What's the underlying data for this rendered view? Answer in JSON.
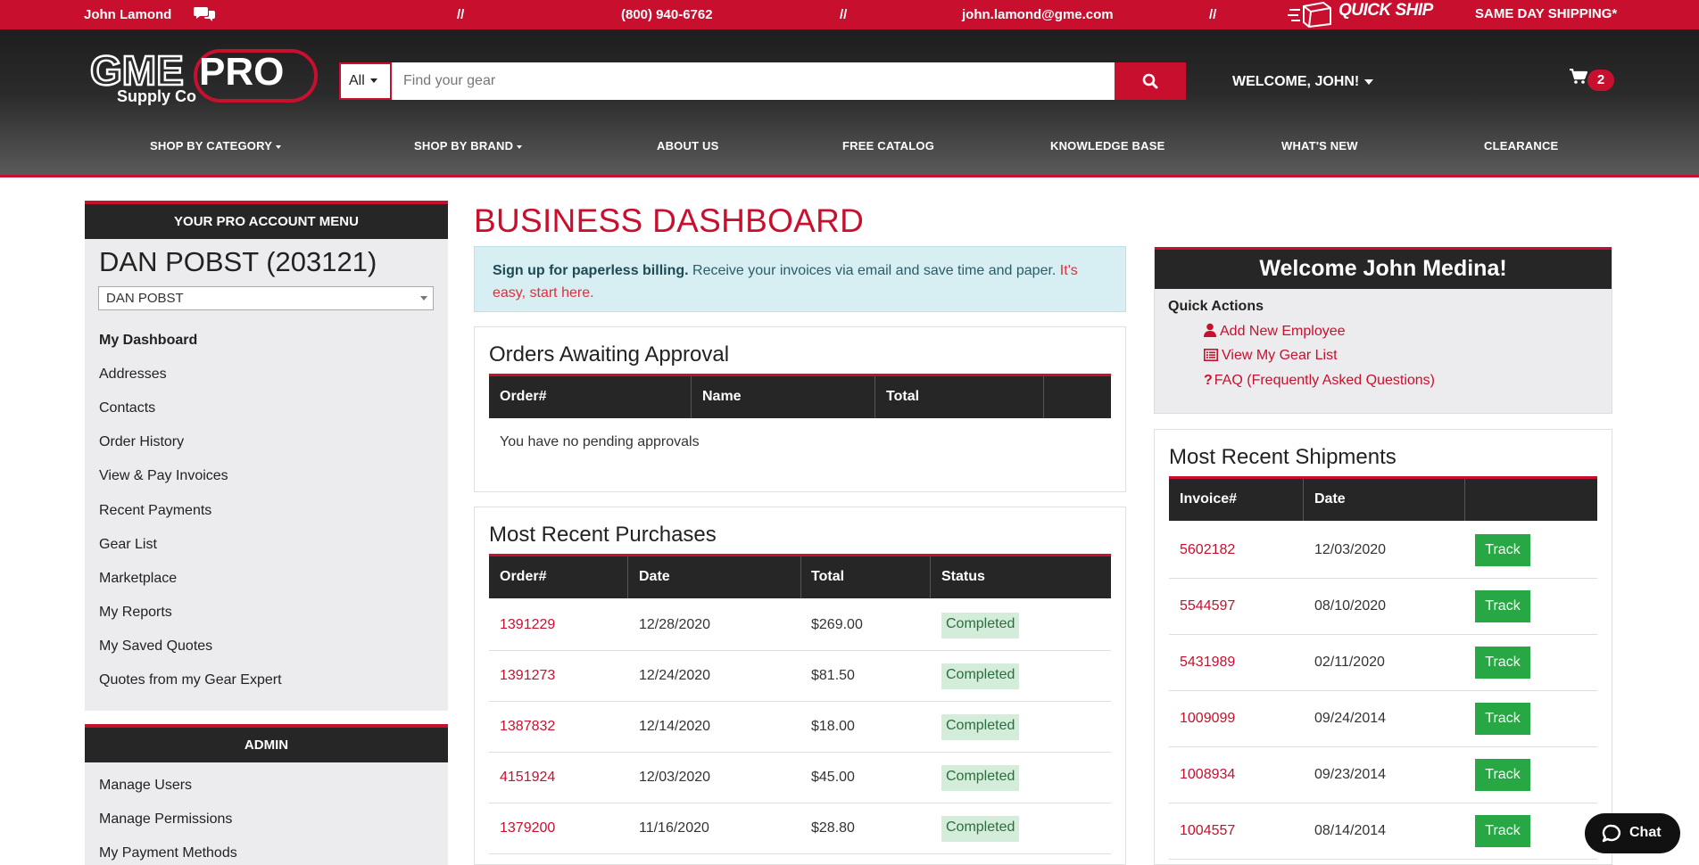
{
  "topbar": {
    "user_name": "John Lamond",
    "separator": "//",
    "phone": "(800) 940-6762",
    "email": "john.lamond@gme.com",
    "quick_ship": "QUICK SHIP",
    "same_day": "SAME DAY SHIPPING*"
  },
  "header": {
    "logo_text_gme": "GME",
    "logo_text_pro": "PRO",
    "logo_text_supply": "Supply Co",
    "search_scope": "All",
    "search_placeholder": "Find your gear",
    "welcome": "WELCOME, JOHN!",
    "cart_count": "2"
  },
  "nav": [
    {
      "label": "SHOP BY CATEGORY",
      "has_dropdown": true
    },
    {
      "label": "SHOP BY BRAND",
      "has_dropdown": true
    },
    {
      "label": "ABOUT US",
      "has_dropdown": false
    },
    {
      "label": "FREE CATALOG",
      "has_dropdown": false
    },
    {
      "label": "KNOWLEDGE BASE",
      "has_dropdown": false
    },
    {
      "label": "WHAT'S NEW",
      "has_dropdown": false
    },
    {
      "label": "CLEARANCE",
      "has_dropdown": false
    }
  ],
  "sidebar": {
    "menu_title": "YOUR PRO ACCOUNT MENU",
    "account_name": "DAN POBST (203121)",
    "account_select_value": "DAN POBST",
    "items": [
      {
        "label": "My Dashboard",
        "active": true
      },
      {
        "label": "Addresses"
      },
      {
        "label": "Contacts"
      },
      {
        "label": "Order History"
      },
      {
        "label": "View & Pay Invoices"
      },
      {
        "label": "Recent Payments"
      },
      {
        "label": "Gear List"
      },
      {
        "label": "Marketplace"
      },
      {
        "label": "My Reports"
      },
      {
        "label": "My Saved Quotes"
      },
      {
        "label": "Quotes from my Gear Expert"
      }
    ],
    "admin_title": "ADMIN",
    "admin_items": [
      {
        "label": "Manage Users"
      },
      {
        "label": "Manage Permissions"
      },
      {
        "label": "My Payment Methods"
      }
    ]
  },
  "main": {
    "title": "BUSINESS DASHBOARD",
    "alert": {
      "bold": "Sign up for paperless billing.",
      "text": " Receive your invoices via email and save time and paper. ",
      "link": "It's easy, start here."
    },
    "approvals": {
      "title": "Orders Awaiting Approval",
      "columns": [
        "Order#",
        "Name",
        "Total",
        ""
      ],
      "empty": "You have no pending approvals"
    },
    "purchases": {
      "title": "Most Recent Purchases",
      "columns": [
        "Order#",
        "Date",
        "Total",
        "Status"
      ],
      "rows": [
        {
          "order": "1391229",
          "date": "12/28/2020",
          "total": "$269.00",
          "status": "Completed"
        },
        {
          "order": "1391273",
          "date": "12/24/2020",
          "total": "$81.50",
          "status": "Completed"
        },
        {
          "order": "1387832",
          "date": "12/14/2020",
          "total": "$18.00",
          "status": "Completed"
        },
        {
          "order": "4151924",
          "date": "12/03/2020",
          "total": "$45.00",
          "status": "Completed"
        },
        {
          "order": "1379200",
          "date": "11/16/2020",
          "total": "$28.80",
          "status": "Completed"
        }
      ]
    }
  },
  "right": {
    "welcome_title": "Welcome John Medina!",
    "quick_actions_title": "Quick Actions",
    "quick_actions": [
      {
        "label": "Add New Employee",
        "icon": "user-icon"
      },
      {
        "label": "View My Gear List",
        "icon": "list-icon"
      },
      {
        "label": "FAQ (Frequently Asked Questions)",
        "icon": "question-icon"
      }
    ],
    "shipments": {
      "title": "Most Recent Shipments",
      "columns": [
        "Invoice#",
        "Date",
        ""
      ],
      "track_label": "Track",
      "rows": [
        {
          "invoice": "5602182",
          "date": "12/03/2020"
        },
        {
          "invoice": "5544597",
          "date": "08/10/2020"
        },
        {
          "invoice": "5431989",
          "date": "02/11/2020"
        },
        {
          "invoice": "1009099",
          "date": "09/24/2014"
        },
        {
          "invoice": "1008934",
          "date": "09/23/2014"
        },
        {
          "invoice": "1004557",
          "date": "08/14/2014"
        }
      ]
    }
  },
  "chat": {
    "label": "Chat"
  },
  "colors": {
    "brand_red": "#c8102e",
    "dark": "#262626",
    "success": "#28a745"
  }
}
